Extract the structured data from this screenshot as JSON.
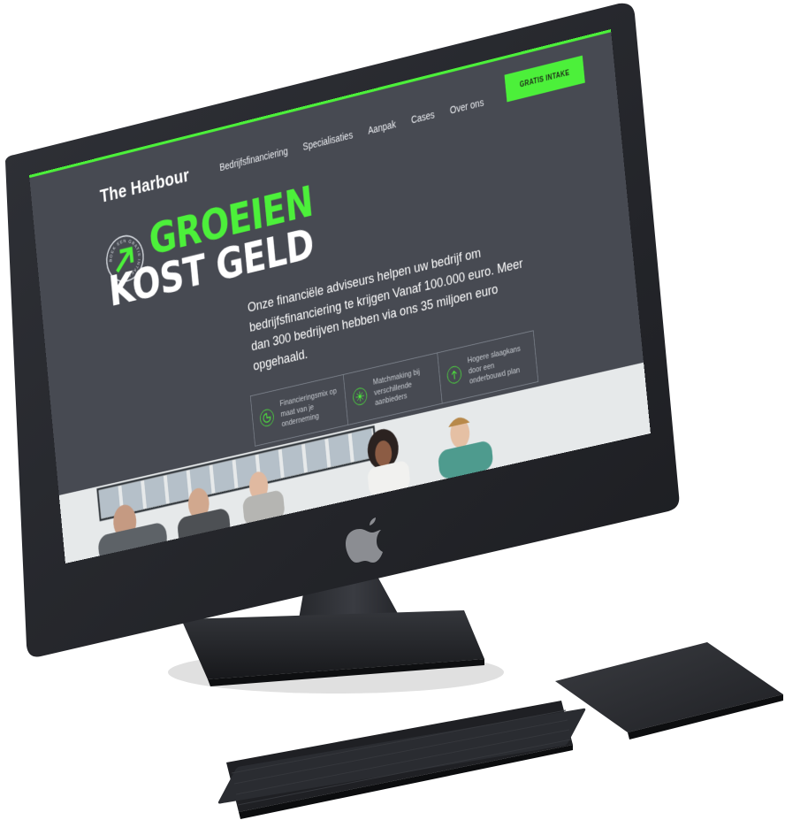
{
  "site": {
    "brand": "The Harbour",
    "nav": [
      "Bedrijfsfinanciering",
      "Specialisaties",
      "Aanpak",
      "Cases",
      "Over ons"
    ],
    "cta": "GRATIS INTAKE",
    "badge": "BOEK EEN GRATIS INTAKE",
    "hero": {
      "line1": "GROEIEN",
      "line2": "KOST GELD"
    },
    "intro": "Onze financiële adviseurs helpen uw bedrijf om bedrijfsfinanciering te krijgen Vanaf 100.000 euro. Meer dan 300 bedrijven hebben via ons 35 miljoen euro opgehaald.",
    "features": [
      {
        "icon": "pie-chart-icon",
        "label": "Financieringsmix op maat van je onderneming"
      },
      {
        "icon": "network-icon",
        "label": "Matchmaking bij verschillende aanbieders"
      },
      {
        "icon": "growth-icon",
        "label": "Hogere slaagkans door een onderbouwd plan"
      }
    ],
    "accent": "#4cf03a",
    "background": "#474a52"
  },
  "hardware": {
    "logo": "apple-logo-icon",
    "devices": [
      "imac-monitor",
      "keyboard",
      "trackpad"
    ]
  }
}
